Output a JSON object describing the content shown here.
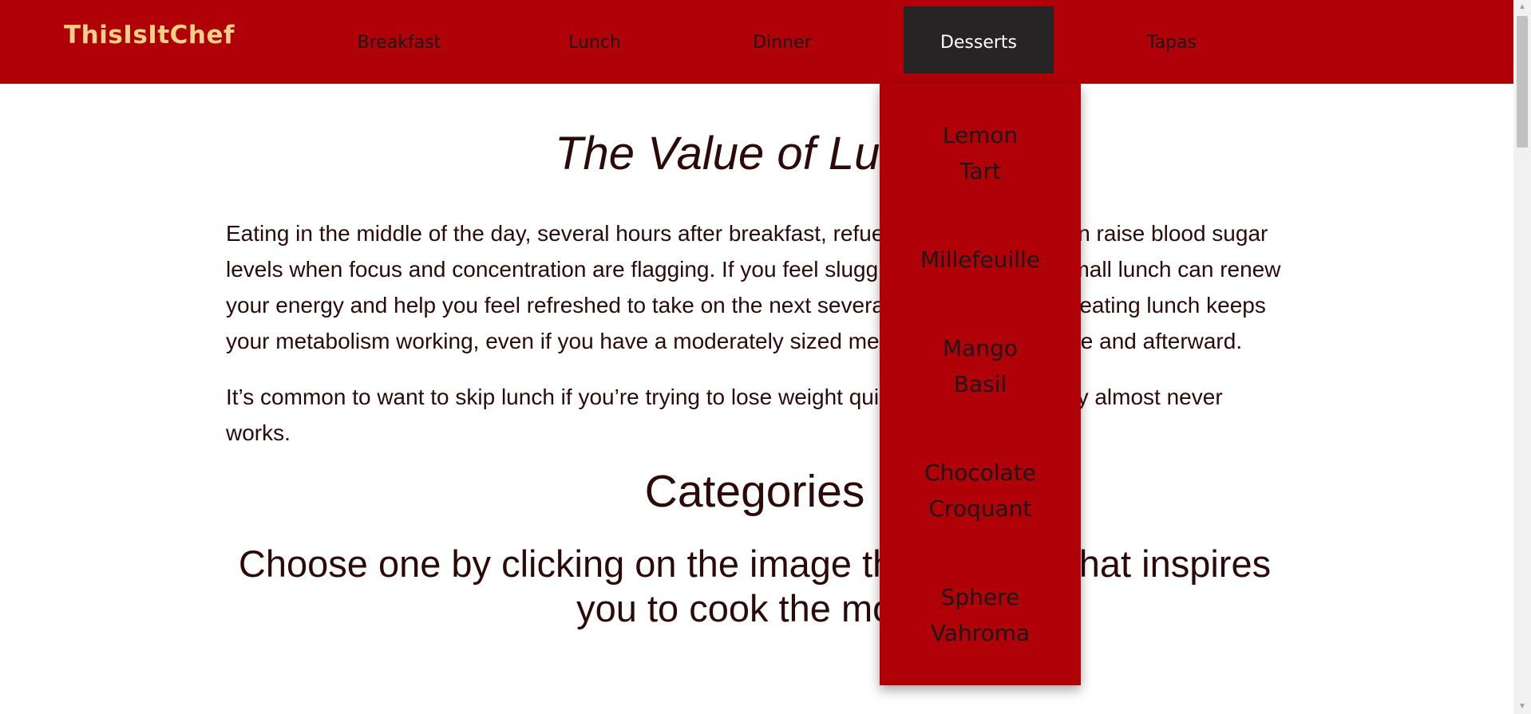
{
  "brand": "ThisIsItChef",
  "nav": {
    "items": [
      "Breakfast",
      "Lunch",
      "Dinner",
      "Desserts",
      "Tapas"
    ],
    "active": "Desserts"
  },
  "dropdown": {
    "items": [
      {
        "line1": "Lemon",
        "line2": "Tart"
      },
      {
        "line1": "Millefeuille",
        "line2": ""
      },
      {
        "line1": "Mango",
        "line2": "Basil"
      },
      {
        "line1": "Chocolate",
        "line2": "Croquant"
      },
      {
        "line1": "Sphere",
        "line2": "Vahroma"
      }
    ]
  },
  "article": {
    "title": "The Value of Lunch",
    "paragraph1": "Eating in the middle of the day, several hours after breakfast, refuels your body and can raise blood sugar levels when focus and concentration are flagging. If you feel sluggish, eating even a small lunch can renew your energy and help you feel refreshed to take on the next several hours. In addition, eating lunch keeps your metabolism working, even if you have a moderately sized meal and a snack before and afterward.",
    "paragraph2": "It’s common to want to skip lunch if you’re trying to lose weight quickly, but that strategy almost never works.",
    "categories_heading": "Categories",
    "choose_heading": "Choose one by clicking on the image that shows what inspires you to cook the most."
  },
  "colors": {
    "brand_red": "#b00008",
    "active_tab": "#262424",
    "brand_text": "#f3d08a",
    "body_text": "#2b0a0a"
  }
}
